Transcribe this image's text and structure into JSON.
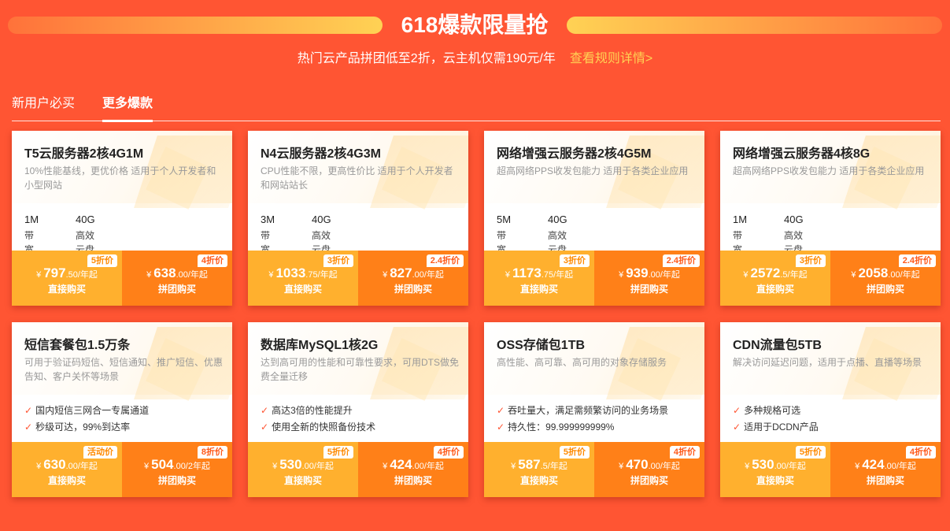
{
  "header": {
    "title": "618爆款限量抢",
    "subtitle": "热门云产品拼团低至2折，云主机仅需190元/年",
    "rules_link": "查看规则详情>"
  },
  "tabs": [
    {
      "label": "新用户必买"
    },
    {
      "label": "更多爆款"
    }
  ],
  "currency": "¥",
  "direct_label": "直接购买",
  "group_label": "拼团购买",
  "cards": [
    {
      "title": "T5云服务器2核4G1M",
      "desc": "10%性能基线，更优价格 适用于个人开发者和小型网站",
      "specs": [
        {
          "value": "1M",
          "label": "带宽"
        },
        {
          "value": "40G",
          "label": "高效云盘"
        }
      ],
      "direct": {
        "badge": "5折价",
        "int": "797",
        "suffix": ".50/年起"
      },
      "group": {
        "badge": "4折价",
        "int": "638",
        "suffix": ".00/年起"
      }
    },
    {
      "title": "N4云服务器2核4G3M",
      "desc": "CPU性能不限，更高性价比 适用于个人开发者和网站站长",
      "specs": [
        {
          "value": "3M",
          "label": "带宽"
        },
        {
          "value": "40G",
          "label": "高效云盘"
        }
      ],
      "direct": {
        "badge": "3折价",
        "int": "1033",
        "suffix": ".75/年起"
      },
      "group": {
        "badge": "2.4折价",
        "int": "827",
        "suffix": ".00/年起"
      }
    },
    {
      "title": "网络增强云服务器2核4G5M",
      "desc": "超高网络PPS收发包能力 适用于各类企业应用",
      "specs": [
        {
          "value": "5M",
          "label": "带宽"
        },
        {
          "value": "40G",
          "label": "高效云盘"
        }
      ],
      "direct": {
        "badge": "3折价",
        "int": "1173",
        "suffix": ".75/年起"
      },
      "group": {
        "badge": "2.4折价",
        "int": "939",
        "suffix": ".00/年起"
      }
    },
    {
      "title": "网络增强云服务器4核8G",
      "desc": "超高网络PPS收发包能力 适用于各类企业应用",
      "specs": [
        {
          "value": "1M",
          "label": "带宽"
        },
        {
          "value": "40G",
          "label": "高效云盘"
        }
      ],
      "direct": {
        "badge": "3折价",
        "int": "2572",
        "suffix": ".5/年起"
      },
      "group": {
        "badge": "2.4折价",
        "int": "2058",
        "suffix": ".00/年起"
      }
    },
    {
      "title": "短信套餐包1.5万条",
      "desc": "可用于验证码短信、短信通知、推广短信、优惠告知、客户关怀等场景",
      "features": [
        "国内短信三网合一专属通道",
        "秒级可达，99%到达率"
      ],
      "direct": {
        "badge": "活动价",
        "int": "630",
        "suffix": ".00/年起"
      },
      "group": {
        "badge": "8折价",
        "int": "504",
        "suffix": ".00/2年起"
      }
    },
    {
      "title": "数据库MySQL1核2G",
      "desc": "达到高可用的性能和可靠性要求，可用DTS做免费全量迁移",
      "features": [
        "高达3倍的性能提升",
        "使用全新的快照备份技术"
      ],
      "direct": {
        "badge": "5折价",
        "int": "530",
        "suffix": ".00/年起"
      },
      "group": {
        "badge": "4折价",
        "int": "424",
        "suffix": ".00/年起"
      }
    },
    {
      "title": "OSS存储包1TB",
      "desc": "高性能、高可靠、高可用的对象存储服务",
      "features": [
        "吞吐量大，满足需频繁访问的业务场景",
        "持久性：99.999999999%"
      ],
      "direct": {
        "badge": "5折价",
        "int": "587",
        "suffix": ".5/年起"
      },
      "group": {
        "badge": "4折价",
        "int": "470",
        "suffix": ".00/年起"
      }
    },
    {
      "title": "CDN流量包5TB",
      "desc": "解决访问延迟问题，适用于点播、直播等场景",
      "features": [
        "多种规格可选",
        "适用于DCDN产品"
      ],
      "direct": {
        "badge": "5折价",
        "int": "530",
        "suffix": ".00/年起"
      },
      "group": {
        "badge": "4折价",
        "int": "424",
        "suffix": ".00/年起"
      }
    }
  ]
}
